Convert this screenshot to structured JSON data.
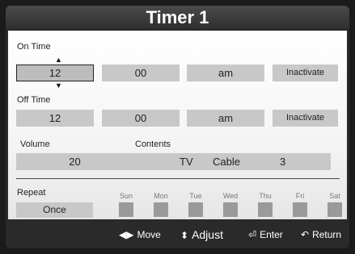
{
  "title": "Timer 1",
  "on_time": {
    "label": "On Time",
    "hour": "12",
    "minute": "00",
    "ampm": "am",
    "status": "Inactivate"
  },
  "off_time": {
    "label": "Off Time",
    "hour": "12",
    "minute": "00",
    "ampm": "am",
    "status": "Inactivate"
  },
  "volume": {
    "label": "Volume",
    "value": "20"
  },
  "contents": {
    "label": "Contents",
    "source": "TV",
    "antenna": "Cable",
    "channel": "3"
  },
  "repeat": {
    "label": "Repeat",
    "value": "Once",
    "days": [
      "Sun",
      "Mon",
      "Tue",
      "Wed",
      "Thu",
      "Fri",
      "Sat"
    ]
  },
  "footer": {
    "move": "Move",
    "adjust": "Adjust",
    "enter": "Enter",
    "return": "Return",
    "icons": {
      "move": "left-right-arrows-icon",
      "adjust": "up-down-arrows-icon",
      "enter": "enter-icon",
      "return": "return-icon"
    }
  }
}
